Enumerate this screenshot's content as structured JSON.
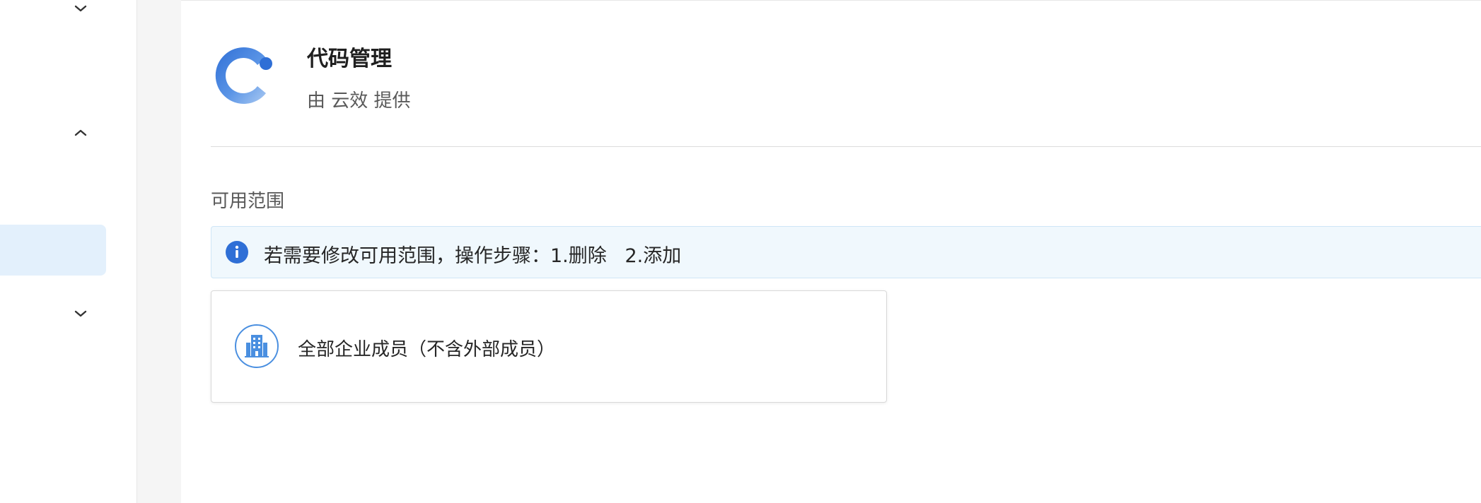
{
  "sidebar": {
    "chevrons": [
      {
        "icon": "chevron-down-icon",
        "direction": "down"
      },
      {
        "icon": "chevron-up-icon",
        "direction": "up"
      },
      {
        "icon": "chevron-down-icon",
        "direction": "down"
      }
    ]
  },
  "app": {
    "title": "代码管理",
    "provider": "由 云效 提供",
    "logo_icon": "codeup-logo-icon"
  },
  "scope": {
    "title": "可用范围",
    "notice": {
      "icon": "info-icon",
      "text": "若需要修改可用范围，操作步骤：1.删除   2.添加"
    },
    "members": [
      {
        "icon": "building-icon",
        "label": "全部企业成员（不含外部成员）"
      }
    ]
  },
  "colors": {
    "accent": "#2f6fd6",
    "logo_light": "#a9c9f2",
    "sidebar_active_bg": "#e3f0fc",
    "notice_bg": "#f0f8fd",
    "notice_border": "#cfe6f7",
    "org_icon": "#4a8fe0"
  }
}
